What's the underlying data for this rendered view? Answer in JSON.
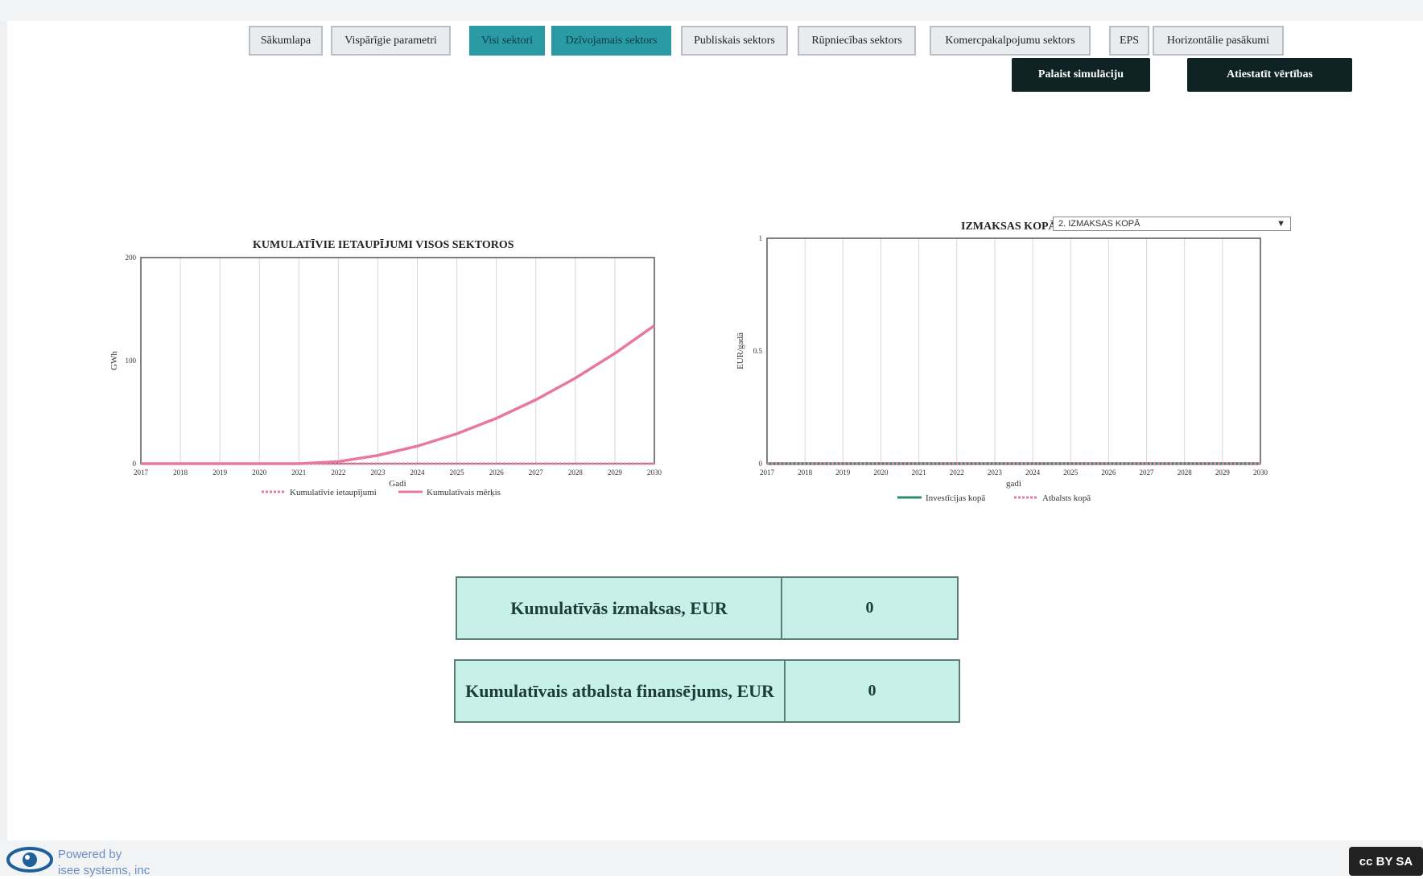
{
  "nav": {
    "tabs": [
      {
        "label": "Sākumlapa"
      },
      {
        "label": "Vispārīgie parametri"
      },
      {
        "label": "Visi sektori"
      },
      {
        "label": "Dzīvojamais sektors"
      },
      {
        "label": "Publiskais sektors"
      },
      {
        "label": "Rūpniecības sektors"
      },
      {
        "label": "Komercpakalpojumu sektors"
      },
      {
        "label": "EPS"
      },
      {
        "label": "Horizontālie pasākumi"
      }
    ],
    "run_label": "Palaist simulāciju",
    "reset_label": "Atiestatīt vērtības"
  },
  "chart_left": {
    "title": "KUMULATĪVIE IETAUPĪJUMI  VISOS SEKTOROS",
    "legend": [
      "Kumulatīvie ietaupījumi",
      "Kumulatīvais mērķis"
    ]
  },
  "chart_right": {
    "title": "IZMAKSAS KOPĀ",
    "dropdown_value": "2. IZMAKSAS KOPĀ",
    "legend": [
      "Investīcijas kopā",
      "Atbalsts kopā"
    ]
  },
  "chart_data": [
    {
      "type": "line",
      "title": "KUMULATĪVIE IETAUPĪJUMI  VISOS SEKTOROS",
      "xlabel": "Gadi",
      "ylabel": "GWh",
      "x": [
        2017,
        2018,
        2019,
        2020,
        2021,
        2022,
        2023,
        2024,
        2025,
        2026,
        2027,
        2028,
        2029,
        2030
      ],
      "xlim": [
        2017,
        2030
      ],
      "ylim": [
        0,
        200
      ],
      "yticks": [
        "0",
        "100",
        "200"
      ],
      "series": [
        {
          "name": "Kumulatīvie ietaupījumi",
          "color": "#e8799a",
          "dash": true,
          "values": [
            0,
            0,
            0,
            0,
            0,
            0,
            0,
            0,
            0,
            0,
            0,
            0,
            0,
            0
          ]
        },
        {
          "name": "Kumulatīvais mērķis",
          "color": "#e8799a",
          "dash": false,
          "values": [
            0,
            0,
            0,
            0,
            0,
            2,
            8,
            17,
            29,
            44,
            62,
            83,
            107,
            134
          ]
        }
      ],
      "grid": true
    },
    {
      "type": "line",
      "title": "IZMAKSAS KOPĀ",
      "xlabel": "gadi",
      "ylabel": "EUR/gadā",
      "x": [
        2017,
        2018,
        2019,
        2020,
        2021,
        2022,
        2023,
        2024,
        2025,
        2026,
        2027,
        2028,
        2029,
        2030
      ],
      "xlim": [
        2017,
        2030
      ],
      "ylim": [
        0,
        1
      ],
      "yticks": [
        "0",
        "0.5",
        "1"
      ],
      "series": [
        {
          "name": "Investīcijas kopā",
          "color": "#2e8b6a",
          "dash": false,
          "values": [
            0,
            0,
            0,
            0,
            0,
            0,
            0,
            0,
            0,
            0,
            0,
            0,
            0,
            0
          ]
        },
        {
          "name": "Atbalsts kopā",
          "color": "#e8799a",
          "dash": true,
          "values": [
            0,
            0,
            0,
            0,
            0,
            0,
            0,
            0,
            0,
            0,
            0,
            0,
            0,
            0
          ]
        }
      ],
      "grid": true
    }
  ],
  "tables": {
    "cost_label": "Kumulatīvās izmaksas, EUR",
    "cost_value": "0",
    "support_label": "Kumulatīvais atbalsta finansējums, EUR",
    "support_value": "0"
  },
  "footer": {
    "powered_line1": "Powered by",
    "powered_line2": "isee systems, inc",
    "license_badge": "cc BY SA"
  }
}
